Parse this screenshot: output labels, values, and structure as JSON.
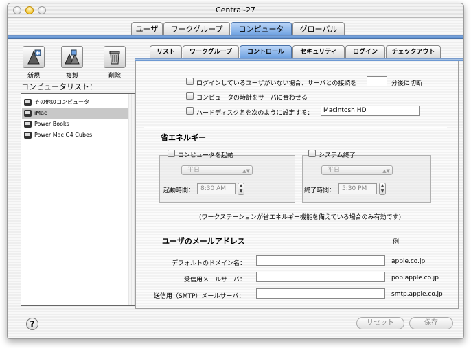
{
  "window": {
    "title": "Central-27"
  },
  "top_tabs": [
    {
      "label": "ユーザ",
      "active": false
    },
    {
      "label": "ワークグループ",
      "active": false
    },
    {
      "label": "コンピュータ",
      "active": true
    },
    {
      "label": "グローバル",
      "active": false
    }
  ],
  "toolbar": {
    "new_label": "新規",
    "copy_label": "複製",
    "delete_label": "削除"
  },
  "computer_list": {
    "title": "コンピュータリスト：",
    "items": [
      {
        "label": "その他のコンピュータ",
        "selected": false
      },
      {
        "label": "iMac",
        "selected": true
      },
      {
        "label": "Power Books",
        "selected": false
      },
      {
        "label": "Power Mac G4 Cubes",
        "selected": false
      }
    ]
  },
  "sub_tabs": [
    {
      "label": "リスト",
      "active": false
    },
    {
      "label": "ワークグループ",
      "active": false
    },
    {
      "label": "コントロール",
      "active": true
    },
    {
      "label": "セキュリティ",
      "active": false
    },
    {
      "label": "ログイン",
      "active": false
    },
    {
      "label": "チェックアウト",
      "active": false
    }
  ],
  "control": {
    "disconnect_label": "ログインしているユーザがいない場合、サーバとの接続を",
    "disconnect_value": "",
    "disconnect_suffix": "分後に切断",
    "sync_clock_label": "コンピュータの時計をサーバに合わせる",
    "set_disk_name_label": "ハードディスク名を次のように設定する：",
    "disk_name_value": "Macintosh HD"
  },
  "energy": {
    "title": "省エネルギー",
    "startup_label": "コンピュータを起動",
    "startup_day": "平日",
    "startup_time_label": "起動時間：",
    "startup_time": "8:30 AM",
    "shutdown_label": "システム終了",
    "shutdown_day": "平日",
    "shutdown_time_label": "終了時間：",
    "shutdown_time": "5:30 PM",
    "note": "(ワークステーションが省エネルギー機能を備えている場合のみ有効です)"
  },
  "mail": {
    "title": "ユーザのメールアドレス",
    "example_header": "例",
    "default_domain_label": "デフォルトのドメイン名：",
    "default_domain_value": "",
    "default_domain_example": "apple.co.jp",
    "incoming_label": "受信用メールサーバ：",
    "incoming_value": "",
    "incoming_example": "pop.apple.co.jp",
    "outgoing_label": "送信用（SMTP）メールサーバ：",
    "outgoing_value": "",
    "outgoing_example": "smtp.apple.co.jp"
  },
  "footer": {
    "help_glyph": "?",
    "revert_label": "リセット",
    "save_label": "保存"
  }
}
